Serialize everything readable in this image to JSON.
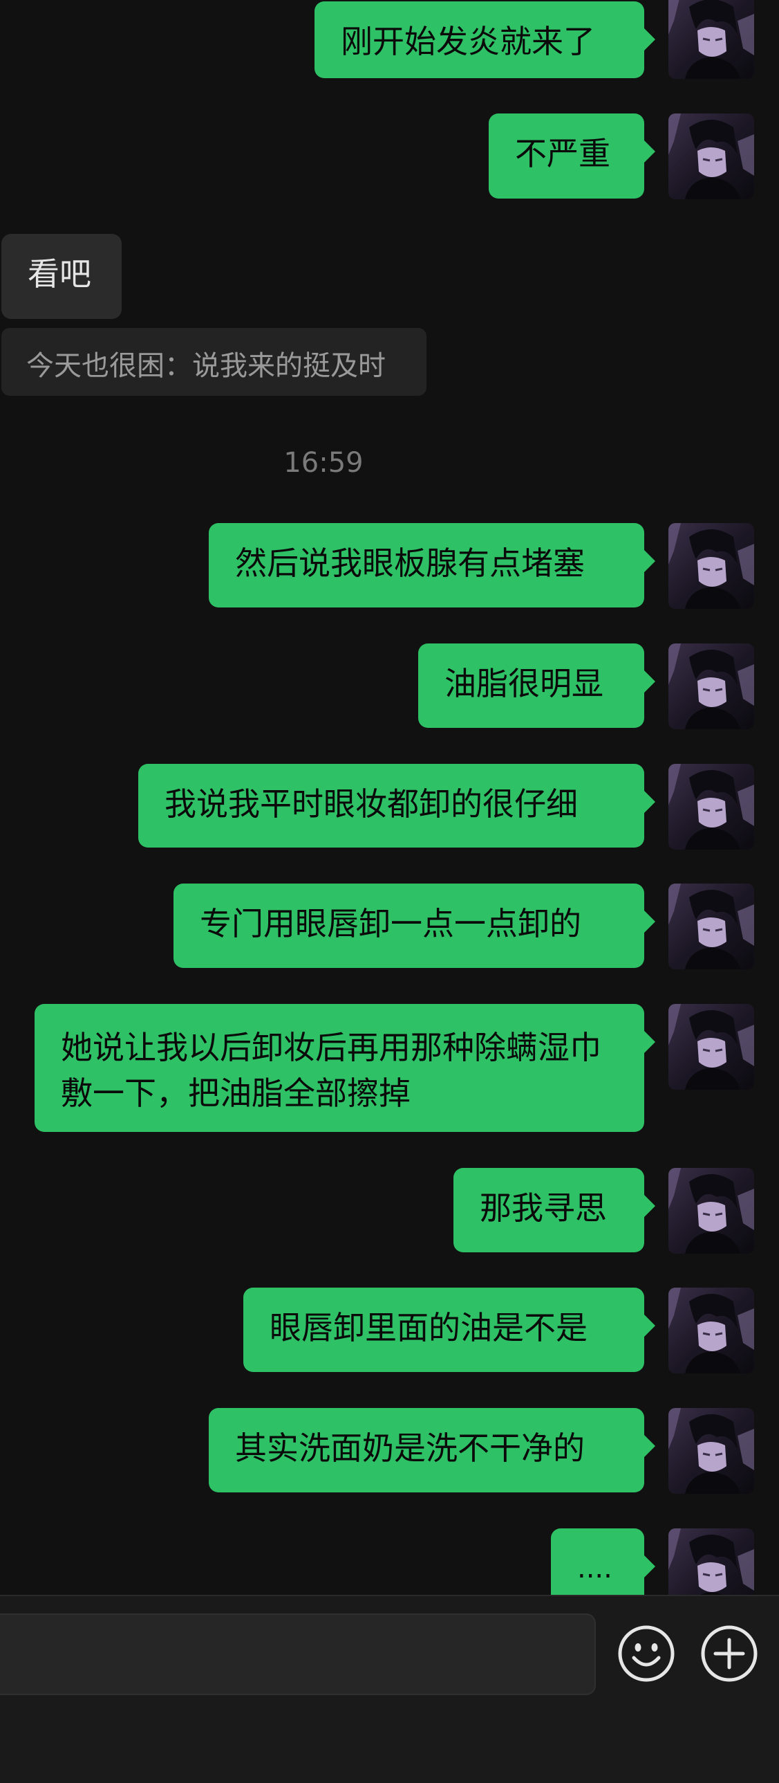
{
  "messages": [
    {
      "text": "刚开始发炎就来了"
    },
    {
      "text": "不严重"
    },
    {
      "text": "看吧"
    },
    {
      "text": "今天也很困：说我来的挺及时"
    },
    {
      "text": "16:59"
    },
    {
      "text": "然后说我眼板腺有点堵塞"
    },
    {
      "text": "油脂很明显"
    },
    {
      "text": "我说我平时眼妆都卸的很仔细"
    },
    {
      "text": "专门用眼唇卸一点一点卸的"
    },
    {
      "text": "她说让我以后卸妆后再用那种除螨湿巾敷一下，把油脂全部擦掉"
    },
    {
      "text": "那我寻思"
    },
    {
      "text": "眼唇卸里面的油是不是"
    },
    {
      "text": "其实洗面奶是洗不干净的"
    },
    {
      "text": "...."
    }
  ],
  "colors": {
    "background": "#111111",
    "outgoing_bubble": "#2ec166",
    "incoming_bubble": "#2b2b2b",
    "quote_bubble": "#232323",
    "input_bar": "#1a1a1a"
  },
  "input_bar": {
    "input_value": "",
    "emoji_icon": "emoji-icon",
    "plus_icon": "plus-circle-icon"
  }
}
